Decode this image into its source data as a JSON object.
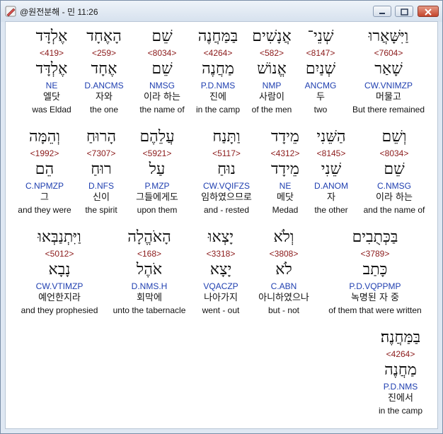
{
  "window": {
    "title": "@원전분해 - 민 11:26"
  },
  "rows": [
    [
      {
        "heb": "וַיִּשָּׁאֲרוּ",
        "num": "<7604>",
        "lemma": "שָׁאַר",
        "code": "CW.VNIMZP",
        "kor": "머물고",
        "eng": "But there remained",
        "selected": true
      },
      {
        "heb": "שְׁנֵי־",
        "num": "<8147>",
        "lemma": "שְׁנַיִם",
        "code": "ANCMG",
        "kor": "두",
        "eng": "two"
      },
      {
        "heb": "אֲנָשִׁים",
        "num": "<582>",
        "lemma": "אֱנוֹשׁ",
        "code": "NMP",
        "kor": "사람이",
        "eng": "of the men"
      },
      {
        "heb": "בַּמַּחֲנֶה",
        "num": "<4264>",
        "lemma": "מַחֲנֶה",
        "code": "P.D.NMS",
        "kor": "진에",
        "eng": "in the camp"
      },
      {
        "heb": "שֵׁם",
        "num": "<8034>",
        "lemma": "שֵׁם",
        "code": "NMSG",
        "kor": "이라 하는",
        "eng": "the name of"
      },
      {
        "heb": "הָאֶחָד",
        "num": "<259>",
        "lemma": "אֶחָד",
        "code": "D.ANCMS",
        "kor": "자와",
        "eng": "the one"
      },
      {
        "heb": "אֶלְדָּד",
        "num": "<419>",
        "lemma": "אֶלְדָּד",
        "code": "NE",
        "kor": "엘닷",
        "eng": "was Eldad"
      }
    ],
    [
      {
        "heb": "וְשֵׁם",
        "num": "<8034>",
        "lemma": "שֵׁם",
        "code": "C.NMSG",
        "kor": "이라 하는",
        "eng": "and the name of"
      },
      {
        "heb": "הַשֵּׁנִי",
        "num": "<8145>",
        "lemma": "שֵׁנִי",
        "code": "D.ANOM",
        "kor": "자",
        "eng": "the other"
      },
      {
        "heb": "מֵידָד",
        "num": "<4312>",
        "lemma": "מֵידָד",
        "code": "NE",
        "kor": "메닷",
        "eng": "Medad"
      },
      {
        "heb": "וַתָּנַח",
        "num": "<5117>",
        "lemma": "נוּחַ",
        "code": "CW.VQIFZS",
        "kor": "임하였으므로",
        "eng": "and - rested"
      },
      {
        "heb": "עֲלֵהֶם",
        "num": "<5921>",
        "lemma": "עַל",
        "code": "P.MZP",
        "kor": "그들에게도",
        "eng": "upon them"
      },
      {
        "heb": "הָרוּחַ",
        "num": "<7307>",
        "lemma": "רוּחַ",
        "code": "D.NFS",
        "kor": "신이",
        "eng": "the spirit"
      },
      {
        "heb": "וְהֵמָּה",
        "num": "<1992>",
        "lemma": "הֵם",
        "code": "C.NPMZP",
        "kor": "그",
        "eng": "and they were"
      }
    ],
    [
      {
        "heb": "בַּכְּתֻבִים",
        "num": "<3789>",
        "lemma": "כָּתַב",
        "code": "P.D.VQPPMP",
        "kor": "녹명된 자 중",
        "eng": "of them that were written"
      },
      {
        "heb": "וְלֹא",
        "num": "<3808>",
        "lemma": "לֹא",
        "code": "C.ABN",
        "kor": "아니하였으나",
        "eng": "but - not"
      },
      {
        "heb": "יָצְאוּ",
        "num": "<3318>",
        "lemma": "יָצָא",
        "code": "VQACZP",
        "kor": "나아가지",
        "eng": "went - out"
      },
      {
        "heb": "הָאֹהֱלָה",
        "num": "<168>",
        "lemma": "אֹהֶל",
        "code": "D.NMS.H",
        "kor": "회막에",
        "eng": "unto the tabernacle"
      },
      {
        "heb": "וַיִּתְנַבְּאוּ",
        "num": "<5012>",
        "lemma": "נָבָא",
        "code": "CW.VTIMZP",
        "kor": "예언한지라",
        "eng": "and they prophesied"
      }
    ],
    [
      {
        "heb": "בַּמַּחֲנֶה׃",
        "num": "<4264>",
        "lemma": "מַחֲנֶה",
        "code": "P.D.NMS",
        "kor": "진에서",
        "eng": "in the camp"
      }
    ]
  ]
}
